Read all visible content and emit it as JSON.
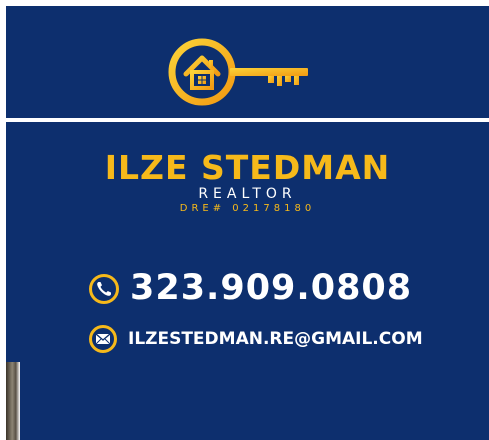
{
  "card": {
    "name": "ILZE STEDMAN",
    "role": "REALTOR",
    "license": "DRE# 02178180",
    "phone": "323.909.0808",
    "email": "ILZESTEDMAN.RE@GMAIL.COM"
  },
  "icons": {
    "logo": "house-key-icon",
    "phone": "phone-icon",
    "email": "envelope-icon"
  },
  "colors": {
    "background": "#0d2f6e",
    "accent": "#f6b91a",
    "text": "#ffffff"
  }
}
